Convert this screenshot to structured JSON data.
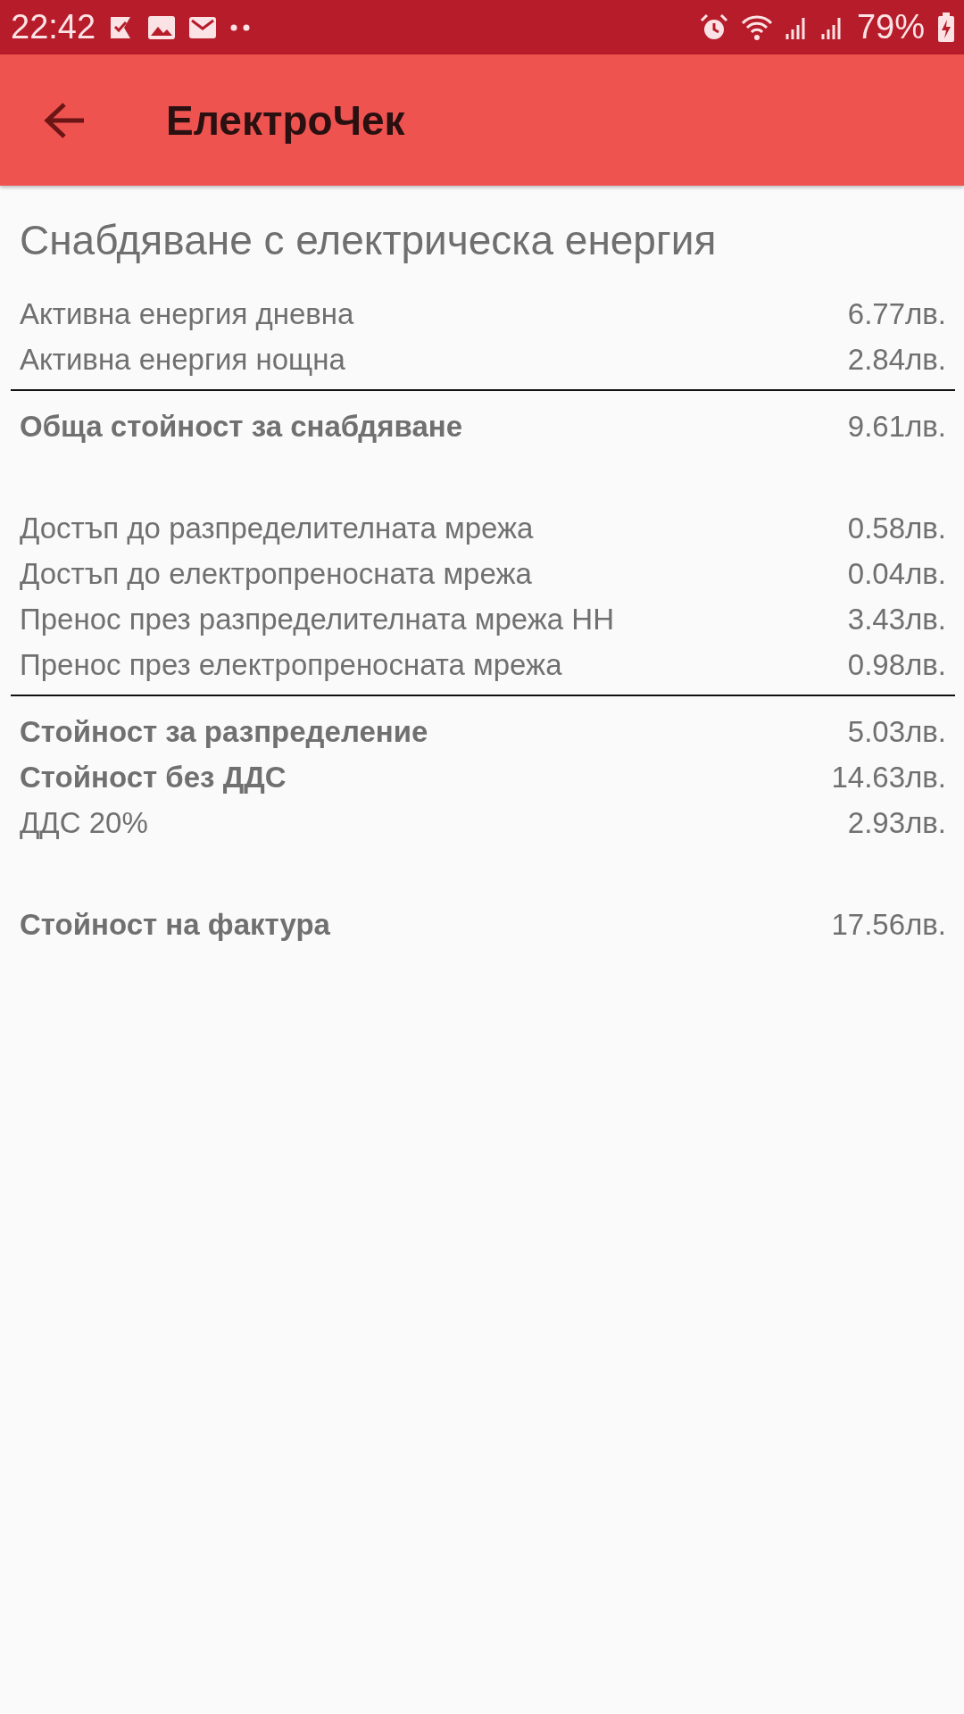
{
  "status_bar": {
    "time": "22:42",
    "battery": "79%"
  },
  "app_bar": {
    "title": "ЕлектроЧек"
  },
  "section_title": "Снабдяване с електрическа енергия",
  "items": [
    {
      "kind": "line",
      "label": "Активна енергия дневна",
      "value": "6.77лв.",
      "bold": false
    },
    {
      "kind": "line",
      "label": "Активна енергия нощна",
      "value": "2.84лв.",
      "bold": false
    },
    {
      "kind": "divider"
    },
    {
      "kind": "line",
      "label": "Обща стойност за снабдяване",
      "value": "9.61лв.",
      "bold": true
    },
    {
      "kind": "gap"
    },
    {
      "kind": "line",
      "label": "Достъп до разпределителната мрежа",
      "value": "0.58лв.",
      "bold": false
    },
    {
      "kind": "line",
      "label": "Достъп до електропреносната мрежа",
      "value": "0.04лв.",
      "bold": false
    },
    {
      "kind": "line",
      "label": "Пренос през разпределителната мрежа НН",
      "value": "3.43лв.",
      "bold": false
    },
    {
      "kind": "line",
      "label": "Пренос през електропреносната мрежа",
      "value": "0.98лв.",
      "bold": false
    },
    {
      "kind": "divider"
    },
    {
      "kind": "line",
      "label": "Стойност за разпределение",
      "value": "5.03лв.",
      "bold": true
    },
    {
      "kind": "line",
      "label": "Стойност без ДДС",
      "value": "14.63лв.",
      "bold": true
    },
    {
      "kind": "line",
      "label": "ДДС 20%",
      "value": "2.93лв.",
      "bold": false
    },
    {
      "kind": "gap"
    },
    {
      "kind": "line",
      "label": "Стойност на фактура",
      "value": "17.56лв.",
      "bold": true
    }
  ]
}
